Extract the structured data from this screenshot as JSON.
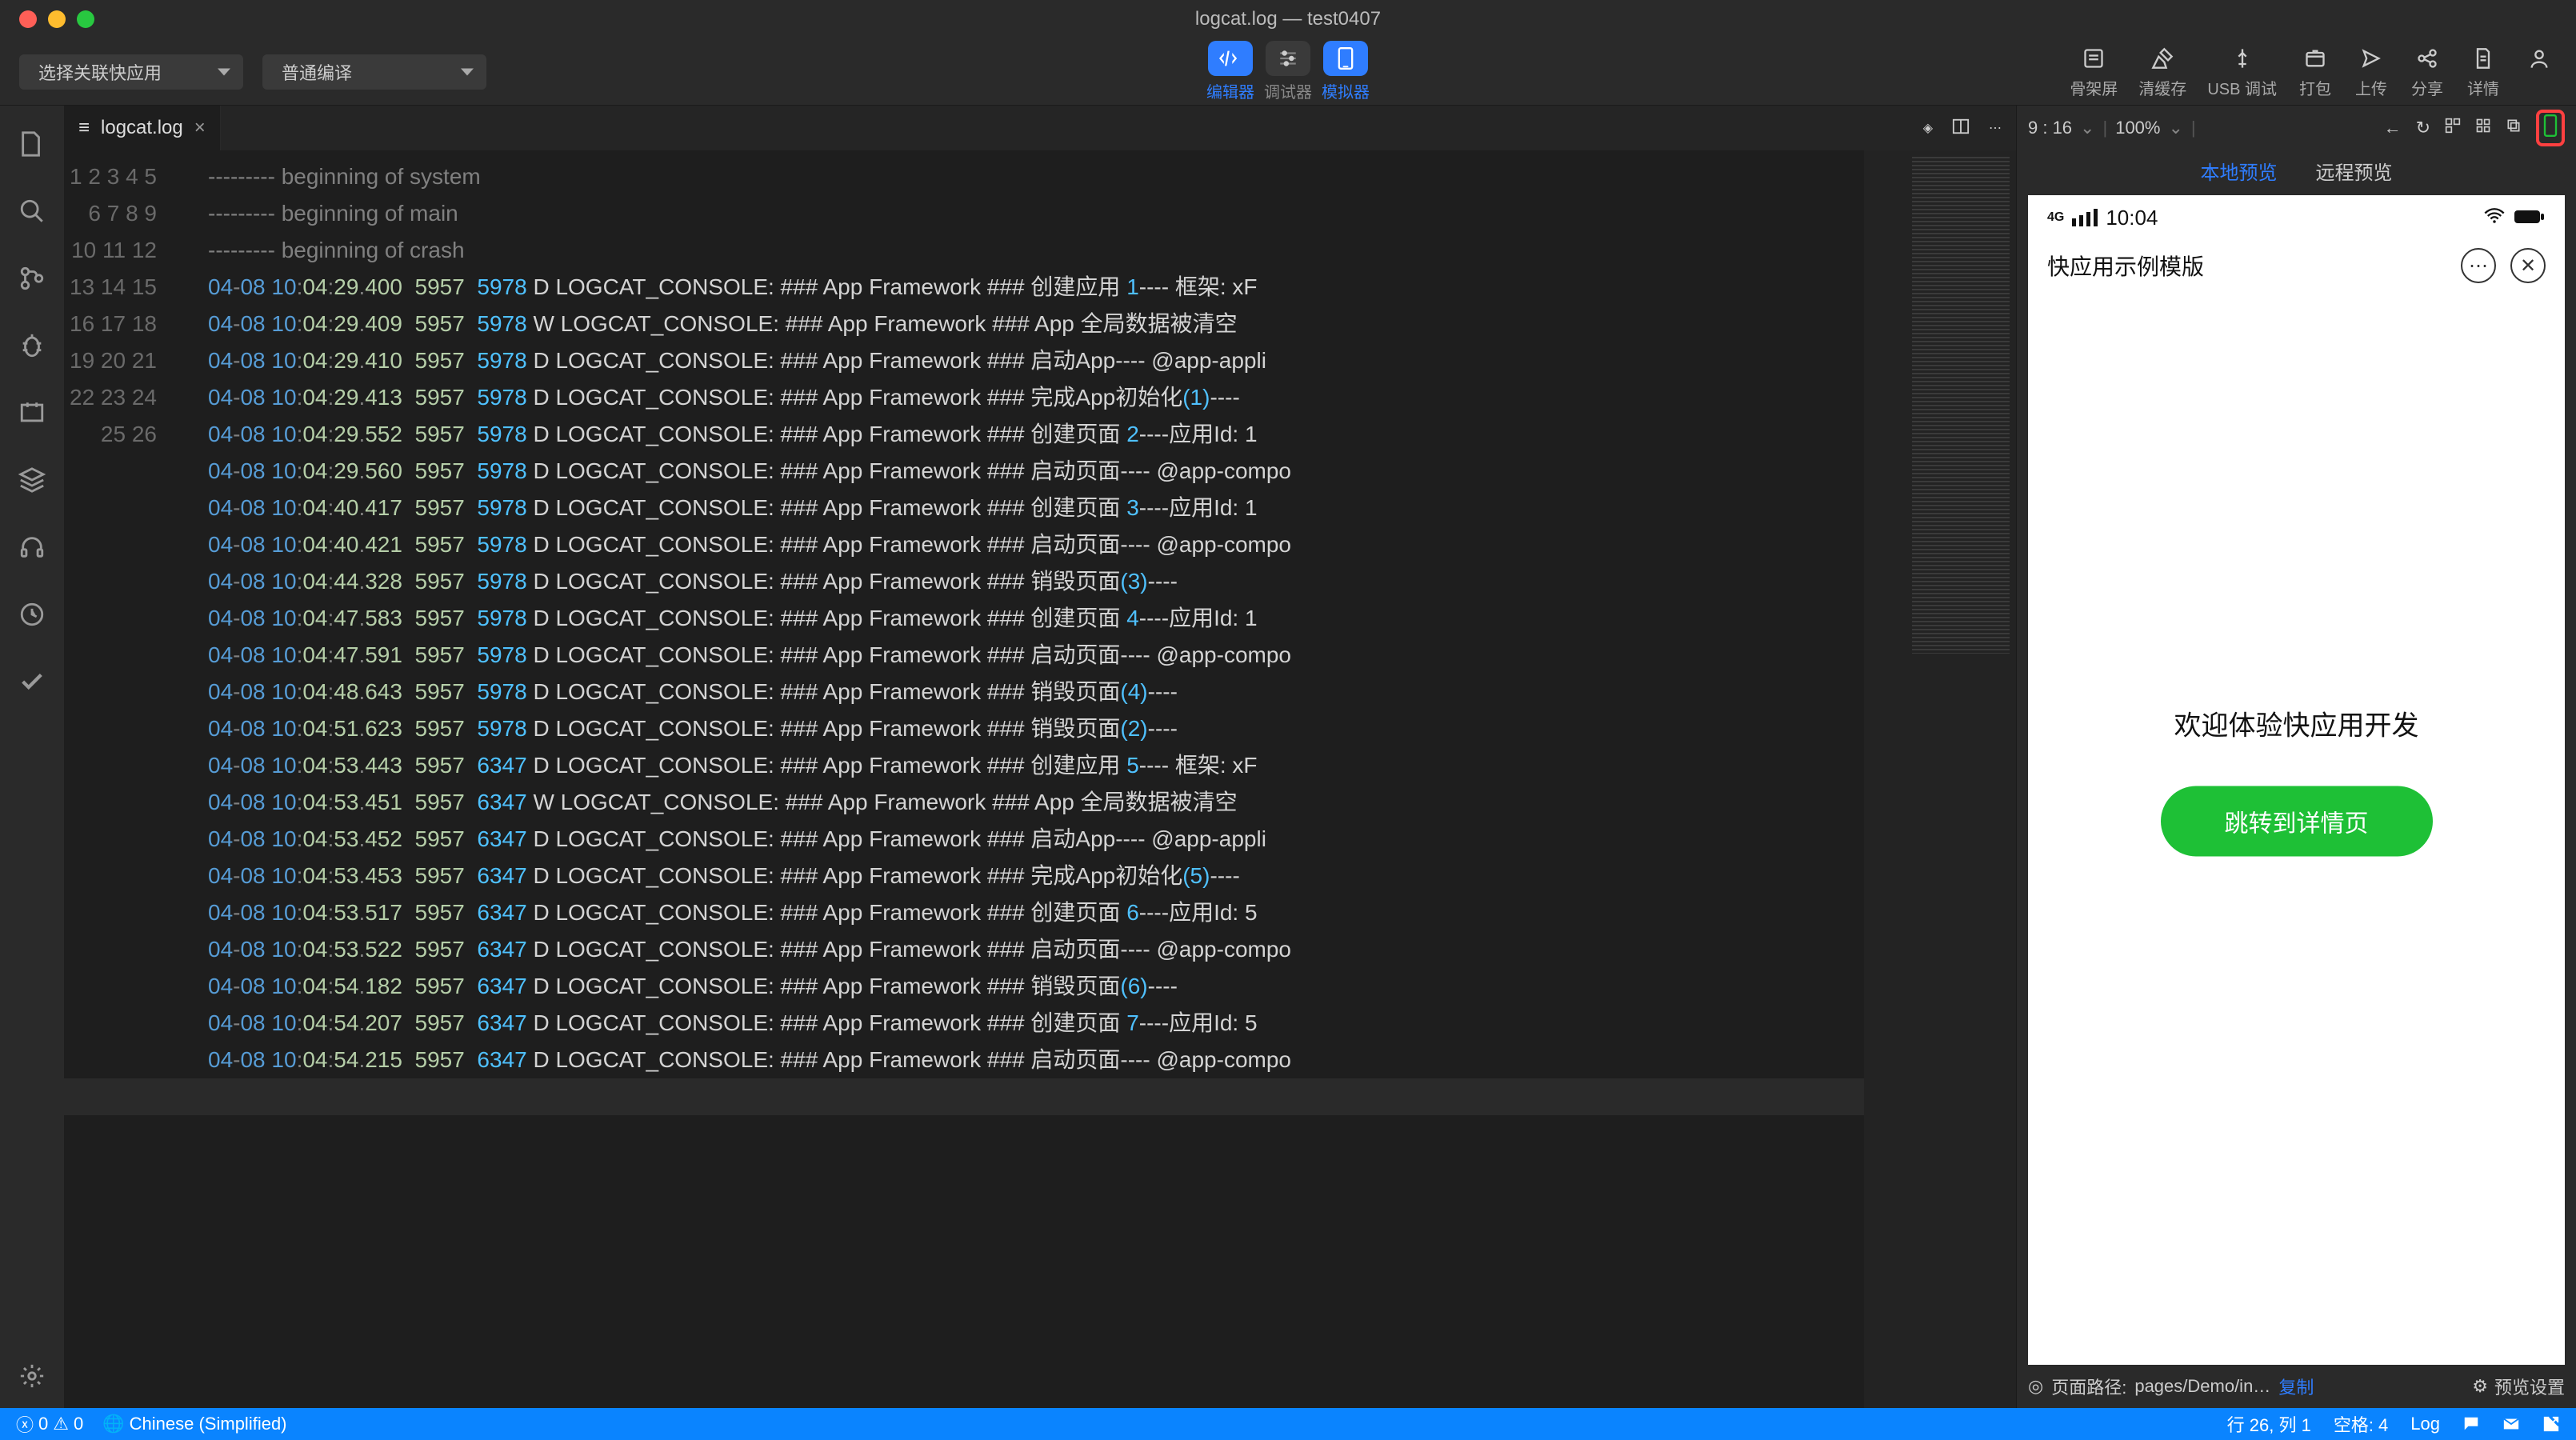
{
  "window": {
    "title": "logcat.log — test0407"
  },
  "toolbar": {
    "select_app": "选择关联快应用",
    "compile_mode": "普通编译",
    "center": {
      "editor": "编辑器",
      "debugger": "调试器",
      "simulator": "模拟器"
    },
    "right": {
      "skeleton": "骨架屏",
      "clear_cache": "清缓存",
      "usb_debug": "USB 调试",
      "package": "打包",
      "upload": "上传",
      "share": "分享",
      "details": "详情"
    }
  },
  "tab": {
    "filename": "logcat.log"
  },
  "preview_bar": {
    "time": "9 : 16",
    "zoom": "100%"
  },
  "preview_tabs": {
    "local": "本地预览",
    "remote": "远程预览"
  },
  "phone": {
    "status_time": "10:04",
    "signal_g": "4G",
    "app_title": "快应用示例模版",
    "welcome": "欢迎体验快应用开发",
    "button": "跳转到详情页"
  },
  "preview_footer": {
    "path_label": "页面路径:",
    "path_value": "pages/Demo/in…",
    "copy": "复制",
    "settings": "预览设置"
  },
  "statusbar": {
    "errors": "0",
    "warnings": "0",
    "lang": "Chinese (Simplified)",
    "ln_col": "行 26, 列 1",
    "spaces": "空格: 4",
    "filetype": "Log"
  },
  "log": {
    "headers": [
      "--------- beginning of system",
      "--------- beginning of main",
      "--------- beginning of crash"
    ],
    "lines": [
      {
        "n": 4,
        "date": "04-08",
        "time": "10:04:29.400",
        "pid": "5957",
        "tid": "5978",
        "lv": "D",
        "tag": "LOGCAT_CONSOLE:",
        "msg": "### App Framework ### 创建应用 ",
        "trail_num": "1",
        "trail": "---- 框架: xF"
      },
      {
        "n": 5,
        "date": "04-08",
        "time": "10:04:29.409",
        "pid": "5957",
        "tid": "5978",
        "lv": "W",
        "tag": "LOGCAT_CONSOLE:",
        "msg": "### App Framework ### App 全局数据被清空",
        "trail_num": "",
        "trail": ""
      },
      {
        "n": 6,
        "date": "04-08",
        "time": "10:04:29.410",
        "pid": "5957",
        "tid": "5978",
        "lv": "D",
        "tag": "LOGCAT_CONSOLE:",
        "msg": "### App Framework ### 启动App---- @app-appli",
        "trail_num": "",
        "trail": ""
      },
      {
        "n": 7,
        "date": "04-08",
        "time": "10:04:29.413",
        "pid": "5957",
        "tid": "5978",
        "lv": "D",
        "tag": "LOGCAT_CONSOLE:",
        "msg": "### App Framework ### 完成App初始化",
        "trail_num": "(1)",
        "trail": "----"
      },
      {
        "n": 8,
        "date": "04-08",
        "time": "10:04:29.552",
        "pid": "5957",
        "tid": "5978",
        "lv": "D",
        "tag": "LOGCAT_CONSOLE:",
        "msg": "### App Framework ### 创建页面 ",
        "trail_num": "2",
        "trail": "----应用Id: 1"
      },
      {
        "n": 9,
        "date": "04-08",
        "time": "10:04:29.560",
        "pid": "5957",
        "tid": "5978",
        "lv": "D",
        "tag": "LOGCAT_CONSOLE:",
        "msg": "### App Framework ### 启动页面---- @app-compo",
        "trail_num": "",
        "trail": ""
      },
      {
        "n": 10,
        "date": "04-08",
        "time": "10:04:40.417",
        "pid": "5957",
        "tid": "5978",
        "lv": "D",
        "tag": "LOGCAT_CONSOLE:",
        "msg": "### App Framework ### 创建页面 ",
        "trail_num": "3",
        "trail": "----应用Id: 1"
      },
      {
        "n": 11,
        "date": "04-08",
        "time": "10:04:40.421",
        "pid": "5957",
        "tid": "5978",
        "lv": "D",
        "tag": "LOGCAT_CONSOLE:",
        "msg": "### App Framework ### 启动页面---- @app-compo",
        "trail_num": "",
        "trail": ""
      },
      {
        "n": 12,
        "date": "04-08",
        "time": "10:04:44.328",
        "pid": "5957",
        "tid": "5978",
        "lv": "D",
        "tag": "LOGCAT_CONSOLE:",
        "msg": "### App Framework ### 销毁页面",
        "trail_num": "(3)",
        "trail": "----"
      },
      {
        "n": 13,
        "date": "04-08",
        "time": "10:04:47.583",
        "pid": "5957",
        "tid": "5978",
        "lv": "D",
        "tag": "LOGCAT_CONSOLE:",
        "msg": "### App Framework ### 创建页面 ",
        "trail_num": "4",
        "trail": "----应用Id: 1"
      },
      {
        "n": 14,
        "date": "04-08",
        "time": "10:04:47.591",
        "pid": "5957",
        "tid": "5978",
        "lv": "D",
        "tag": "LOGCAT_CONSOLE:",
        "msg": "### App Framework ### 启动页面---- @app-compo",
        "trail_num": "",
        "trail": ""
      },
      {
        "n": 15,
        "date": "04-08",
        "time": "10:04:48.643",
        "pid": "5957",
        "tid": "5978",
        "lv": "D",
        "tag": "LOGCAT_CONSOLE:",
        "msg": "### App Framework ### 销毁页面",
        "trail_num": "(4)",
        "trail": "----"
      },
      {
        "n": 16,
        "date": "04-08",
        "time": "10:04:51.623",
        "pid": "5957",
        "tid": "5978",
        "lv": "D",
        "tag": "LOGCAT_CONSOLE:",
        "msg": "### App Framework ### 销毁页面",
        "trail_num": "(2)",
        "trail": "----"
      },
      {
        "n": 17,
        "date": "04-08",
        "time": "10:04:53.443",
        "pid": "5957",
        "tid": "6347",
        "lv": "D",
        "tag": "LOGCAT_CONSOLE:",
        "msg": "### App Framework ### 创建应用 ",
        "trail_num": "5",
        "trail": "---- 框架: xF"
      },
      {
        "n": 18,
        "date": "04-08",
        "time": "10:04:53.451",
        "pid": "5957",
        "tid": "6347",
        "lv": "W",
        "tag": "LOGCAT_CONSOLE:",
        "msg": "### App Framework ### App 全局数据被清空",
        "trail_num": "",
        "trail": ""
      },
      {
        "n": 19,
        "date": "04-08",
        "time": "10:04:53.452",
        "pid": "5957",
        "tid": "6347",
        "lv": "D",
        "tag": "LOGCAT_CONSOLE:",
        "msg": "### App Framework ### 启动App---- @app-appli",
        "trail_num": "",
        "trail": ""
      },
      {
        "n": 20,
        "date": "04-08",
        "time": "10:04:53.453",
        "pid": "5957",
        "tid": "6347",
        "lv": "D",
        "tag": "LOGCAT_CONSOLE:",
        "msg": "### App Framework ### 完成App初始化",
        "trail_num": "(5)",
        "trail": "----"
      },
      {
        "n": 21,
        "date": "04-08",
        "time": "10:04:53.517",
        "pid": "5957",
        "tid": "6347",
        "lv": "D",
        "tag": "LOGCAT_CONSOLE:",
        "msg": "### App Framework ### 创建页面 ",
        "trail_num": "6",
        "trail": "----应用Id: 5"
      },
      {
        "n": 22,
        "date": "04-08",
        "time": "10:04:53.522",
        "pid": "5957",
        "tid": "6347",
        "lv": "D",
        "tag": "LOGCAT_CONSOLE:",
        "msg": "### App Framework ### 启动页面---- @app-compo",
        "trail_num": "",
        "trail": ""
      },
      {
        "n": 23,
        "date": "04-08",
        "time": "10:04:54.182",
        "pid": "5957",
        "tid": "6347",
        "lv": "D",
        "tag": "LOGCAT_CONSOLE:",
        "msg": "### App Framework ### 销毁页面",
        "trail_num": "(6)",
        "trail": "----"
      },
      {
        "n": 24,
        "date": "04-08",
        "time": "10:04:54.207",
        "pid": "5957",
        "tid": "6347",
        "lv": "D",
        "tag": "LOGCAT_CONSOLE:",
        "msg": "### App Framework ### 创建页面 ",
        "trail_num": "7",
        "trail": "----应用Id: 5"
      },
      {
        "n": 25,
        "date": "04-08",
        "time": "10:04:54.215",
        "pid": "5957",
        "tid": "6347",
        "lv": "D",
        "tag": "LOGCAT_CONSOLE:",
        "msg": "### App Framework ### 启动页面---- @app-compo",
        "trail_num": "",
        "trail": ""
      }
    ],
    "last_line_number": 26
  }
}
